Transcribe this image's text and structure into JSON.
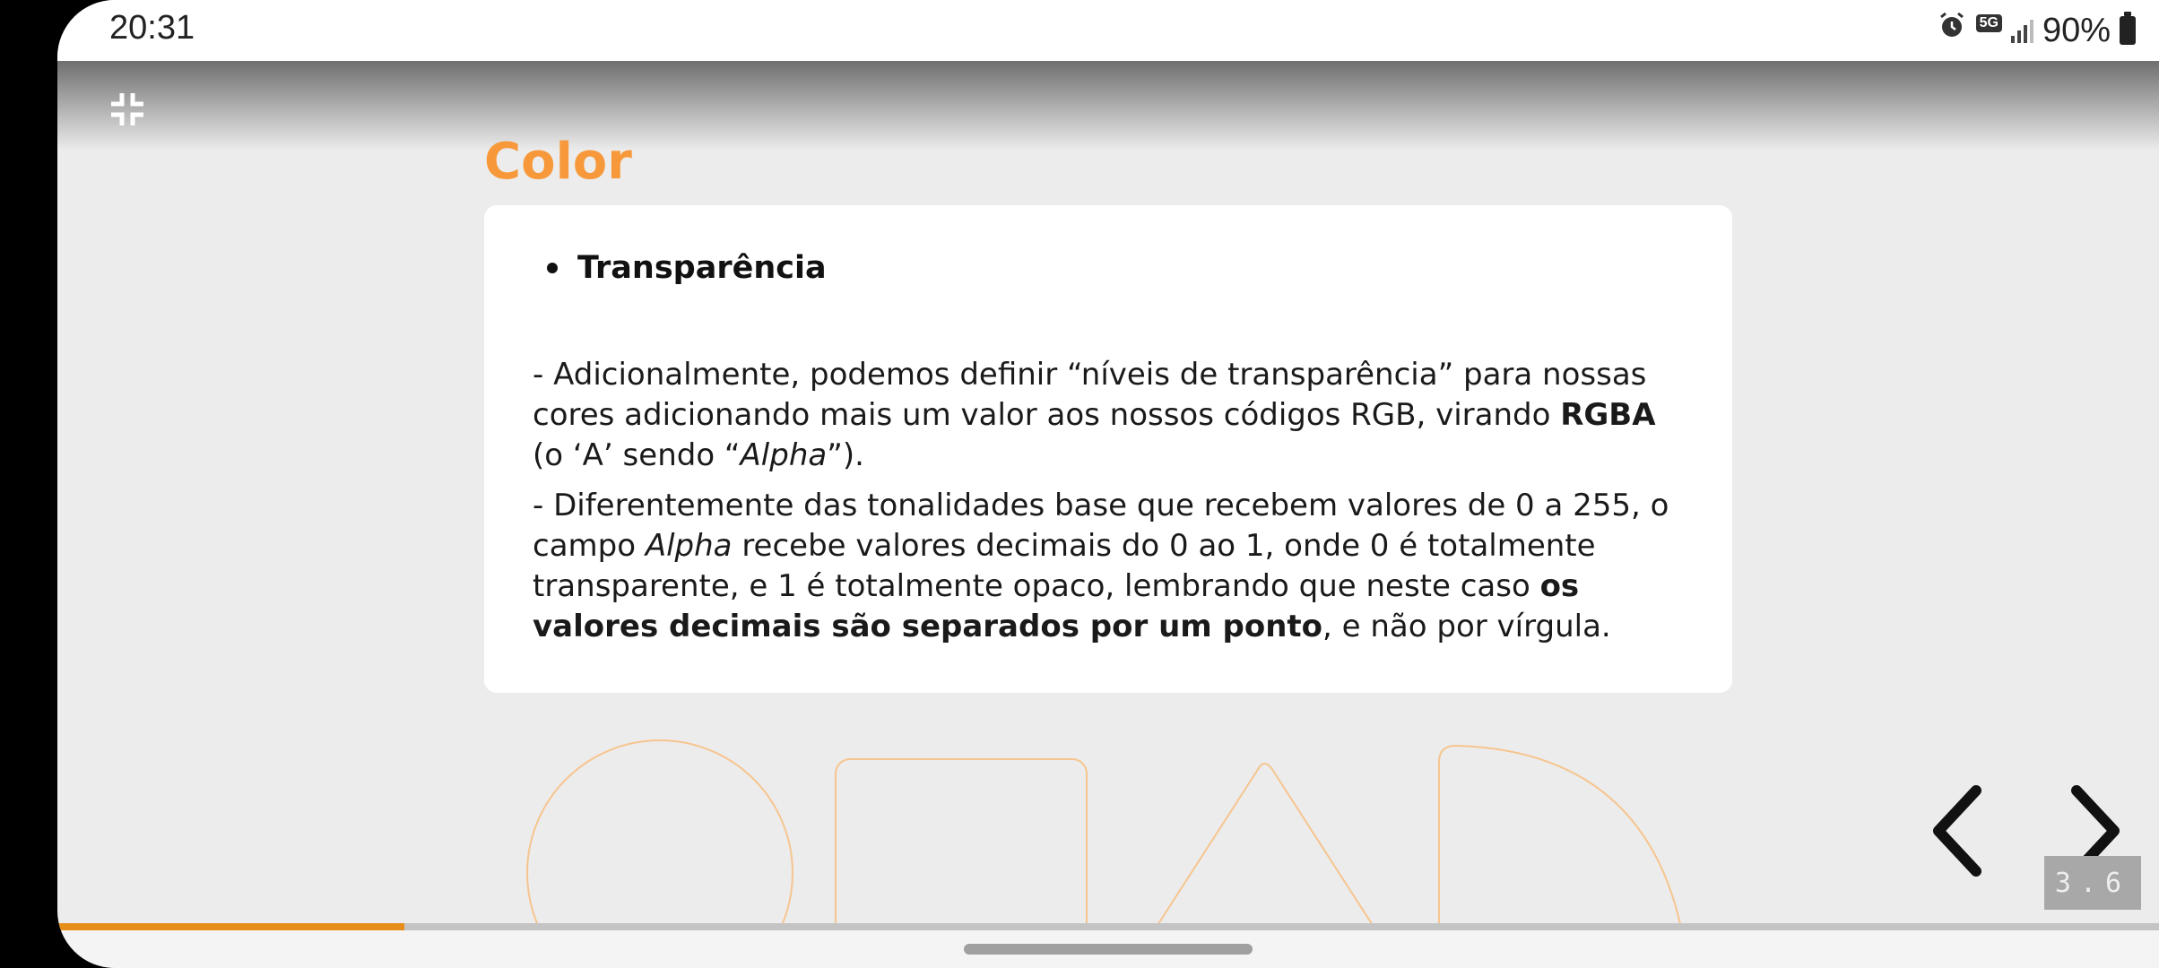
{
  "status_bar": {
    "time": "20:31",
    "network": "5G",
    "battery": "90%",
    "icons": [
      "alarm-icon",
      "5g-icon",
      "signal-icon",
      "battery-icon"
    ]
  },
  "slide": {
    "title": "Color",
    "bullet": "Transparência",
    "paragraph1": {
      "part1": "- Adicionalmente, podemos definir “níveis de transparência” para nossas cores adicionando mais um valor aos nossos códigos RGB, virando ",
      "bold": "RGBA",
      "part2": " (o ‘A’ sendo “",
      "italic": "Alpha",
      "part3": "”)."
    },
    "paragraph2": {
      "part1": "- Diferentemente das tonalidades base que recebem valores de 0 a 255, o campo ",
      "italic": "Alpha",
      "part2": " recebe valores decimais do 0 ao 1, onde 0 é totalmente transparente, e 1 é totalmente opaco, lembrando que neste caso ",
      "bold": "os valores decimais são separados por um ponto",
      "part3": ", e não por vírgula."
    }
  },
  "navigation": {
    "counter": "3.6",
    "progress_fraction": 0.165
  },
  "colors": {
    "accent": "#f7993a",
    "progress": "#e58e1a",
    "background": "#ececec"
  }
}
